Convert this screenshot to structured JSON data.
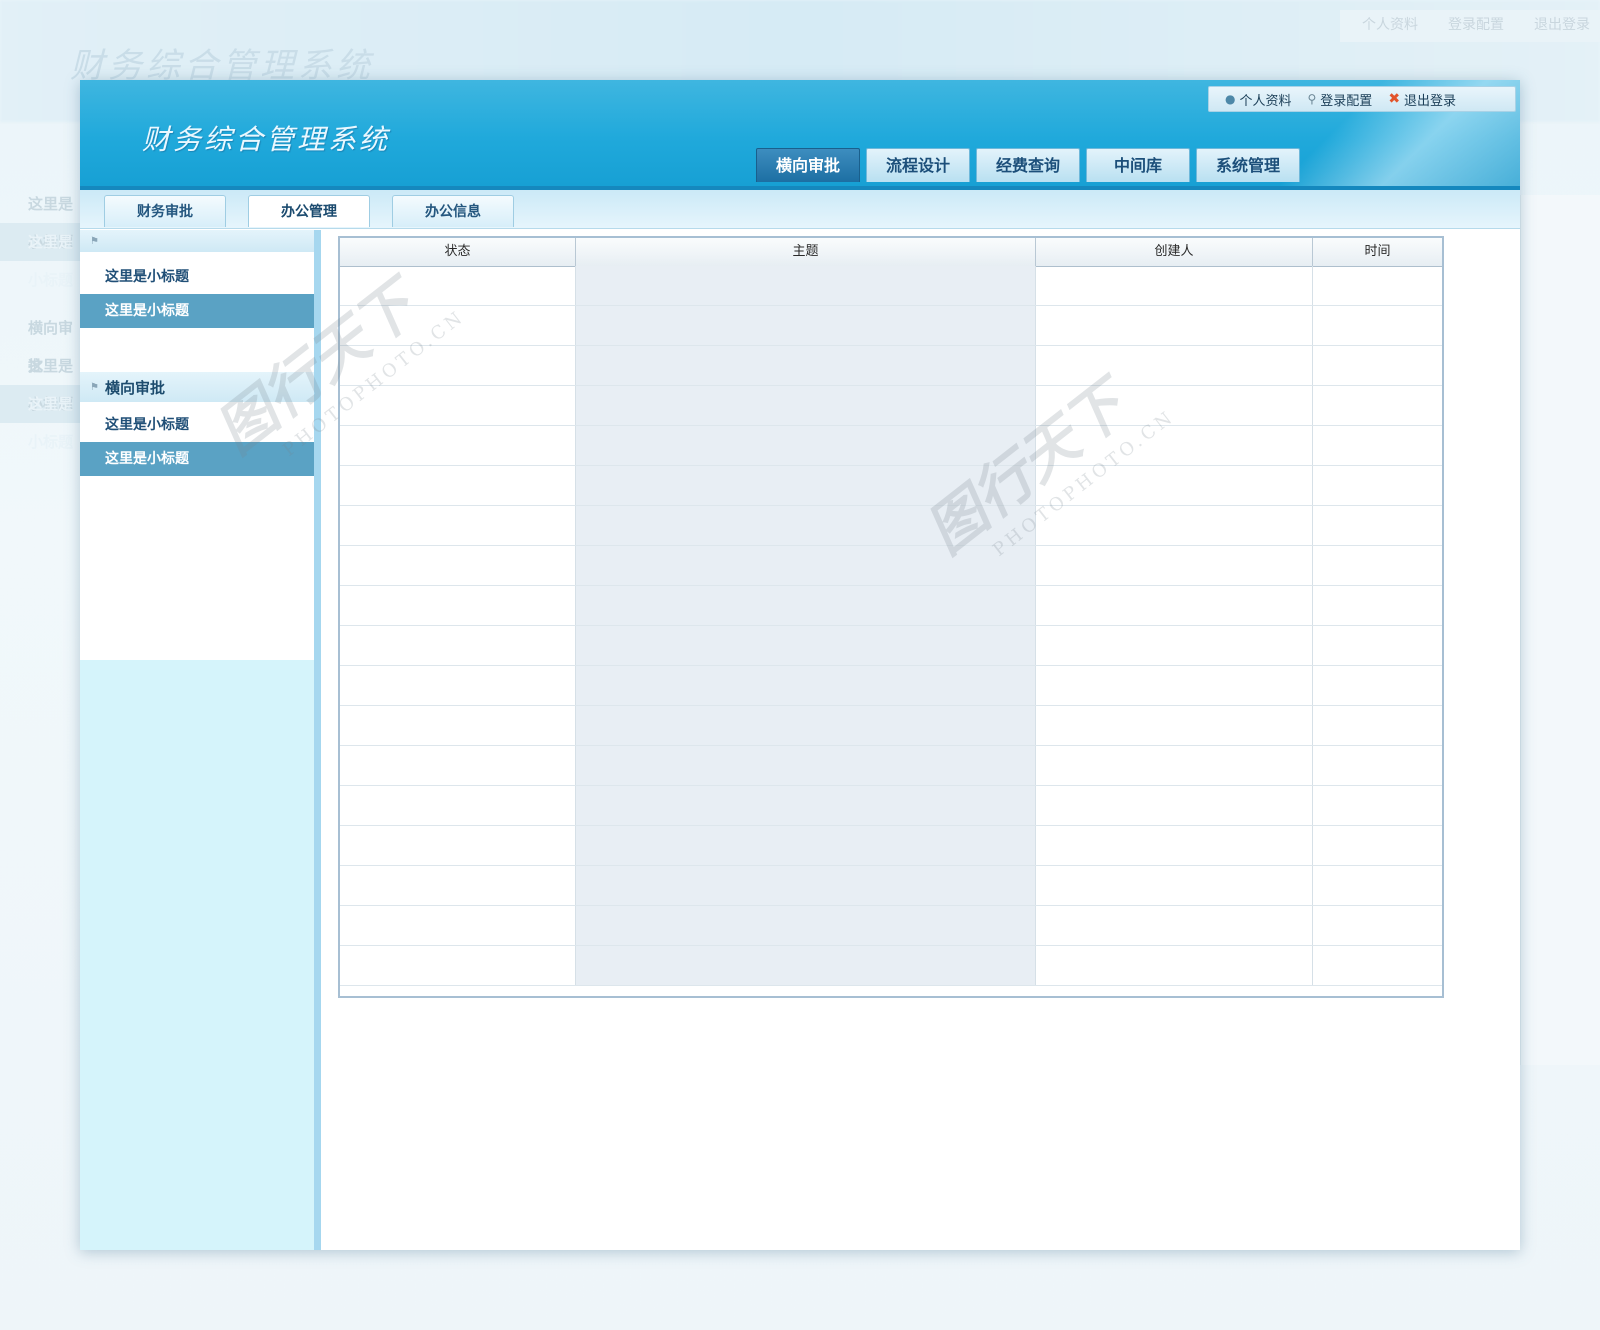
{
  "app": {
    "title": "财务综合管理系统"
  },
  "util_links": [
    {
      "label": "个人资料",
      "icon": "user-icon"
    },
    {
      "label": "登录配置",
      "icon": "key-icon"
    },
    {
      "label": "退出登录",
      "icon": "close-icon"
    }
  ],
  "main_tabs": [
    {
      "label": "横向审批",
      "active": true
    },
    {
      "label": "流程设计"
    },
    {
      "label": "经费查询"
    },
    {
      "label": "中间库"
    },
    {
      "label": "系统管理"
    }
  ],
  "sub_tabs": [
    {
      "label": "财务审批"
    },
    {
      "label": "办公管理",
      "active": true
    },
    {
      "label": "办公信息"
    }
  ],
  "sidebar": {
    "group1": {
      "items": [
        {
          "label": "这里是小标题"
        },
        {
          "label": "这里是小标题",
          "selected": true
        }
      ]
    },
    "group2": {
      "title": "横向审批",
      "items": [
        {
          "label": "这里是小标题"
        },
        {
          "label": "这里是小标题",
          "selected": true
        }
      ]
    }
  },
  "table": {
    "columns": [
      "状态",
      "主题",
      "创建人",
      "时间"
    ],
    "row_count": 18
  },
  "watermark": {
    "text": "图行天下",
    "sub": "PHOTOPHOTO.CN"
  },
  "colors": {
    "header": "#20a9db",
    "active_tab": "#1d6fa3",
    "selected_item": "#5aa2c4"
  }
}
